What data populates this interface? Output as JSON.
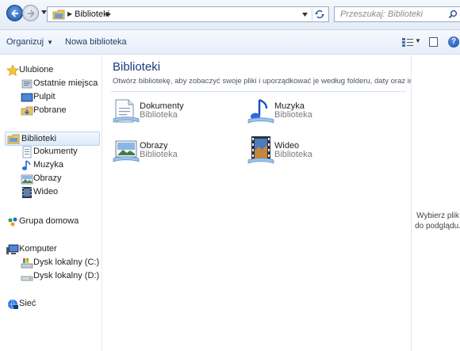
{
  "addressbar": {
    "path": "Biblioteki",
    "search_placeholder": "Przeszukaj: Biblioteki"
  },
  "commandbar": {
    "organize": "Organizuj",
    "new_library": "Nowa biblioteka"
  },
  "navpane": {
    "favorites": {
      "label": "Ulubione",
      "items": [
        "Ostatnie miejsca",
        "Pulpit",
        "Pobrane"
      ]
    },
    "libraries": {
      "label": "Biblioteki",
      "items": [
        "Dokumenty",
        "Muzyka",
        "Obrazy",
        "Wideo"
      ]
    },
    "homegroup": "Grupa domowa",
    "computer": {
      "label": "Komputer",
      "items": [
        "Dysk lokalny (C:)",
        "Dysk lokalny (D:)"
      ]
    },
    "network": "Sieć"
  },
  "content": {
    "title": "Biblioteki",
    "subtitle": "Otwórz bibliotekę, aby zobaczyć swoje pliki i uporządkować je według folderu, daty oraz innych wł...",
    "tiles": [
      {
        "name": "Dokumenty",
        "type": "Biblioteka",
        "icon": "documents-library-icon"
      },
      {
        "name": "Muzyka",
        "type": "Biblioteka",
        "icon": "music-library-icon"
      },
      {
        "name": "Obrazy",
        "type": "Biblioteka",
        "icon": "pictures-library-icon"
      },
      {
        "name": "Wideo",
        "type": "Biblioteka",
        "icon": "videos-library-icon"
      }
    ]
  },
  "preview": {
    "text": "Wybierz plik do podglądu."
  },
  "colors": {
    "title_blue": "#1c3c7e",
    "command_text": "#1e3d6b",
    "selection_bg": "#dde9fb"
  }
}
